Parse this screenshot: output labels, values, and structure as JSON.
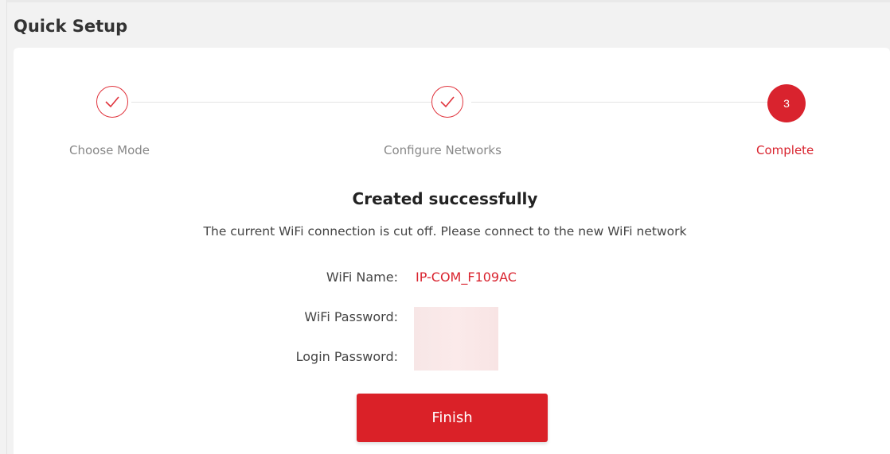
{
  "header": {
    "title": "Quick Setup"
  },
  "steps": [
    {
      "label": "Choose Mode",
      "state": "done"
    },
    {
      "label": "Configure Networks",
      "state": "done"
    },
    {
      "label": "Complete",
      "number": "3",
      "state": "active"
    }
  ],
  "result": {
    "heading": "Created successfully",
    "message": "The current WiFi connection is cut off. Please connect to the new WiFi network"
  },
  "fields": {
    "wifi_name_label": "WiFi Name:",
    "wifi_name_value": "IP-COM_F109AC",
    "wifi_password_label": "WiFi Password:",
    "login_password_label": "Login Password:"
  },
  "actions": {
    "finish_label": "Finish"
  },
  "colors": {
    "accent": "#d9232e",
    "background": "#f2f2f2",
    "card": "#ffffff"
  }
}
